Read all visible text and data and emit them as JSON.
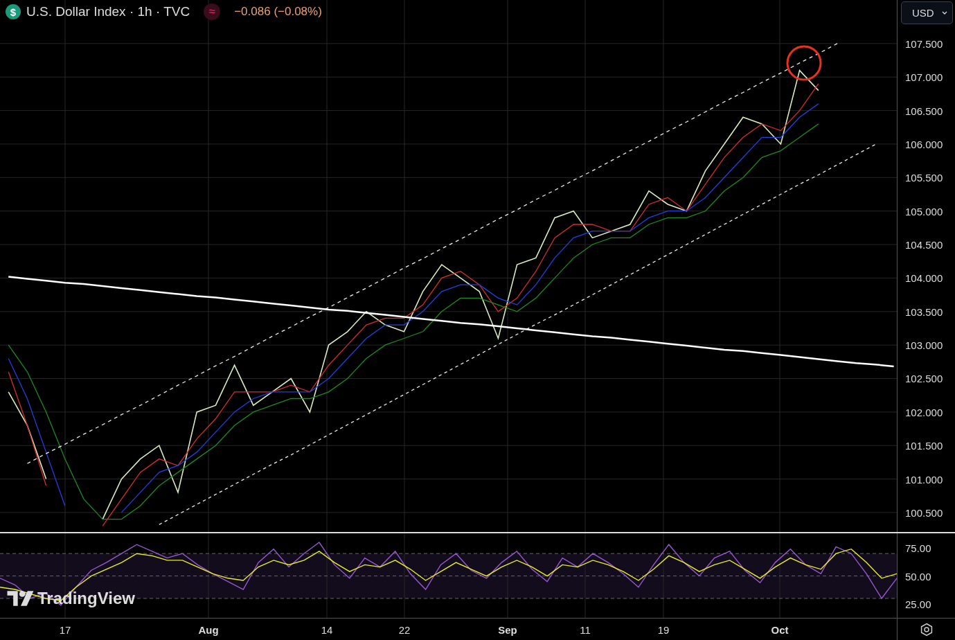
{
  "header": {
    "symbol_icon": "$",
    "title": "U.S. Dollar Index · 1h · TVC",
    "indicator_icon": "≈",
    "change": "−0.086 (−0.08%)"
  },
  "currency_button": {
    "label": "USD"
  },
  "price_chart": {
    "chart_data": {
      "type": "line",
      "grid": true,
      "ylim": [
        100.21,
        108.15
      ],
      "categories": [
        null,
        null,
        null,
        null,
        null,
        null,
        null,
        null,
        null,
        null,
        null,
        null,
        null,
        null,
        null,
        null,
        null,
        null,
        null,
        null,
        null,
        null,
        null,
        null,
        null,
        null,
        null,
        null,
        null,
        null,
        null,
        null,
        null,
        null,
        null,
        null,
        null,
        null,
        null,
        null,
        null,
        null,
        null,
        null,
        null,
        null,
        null,
        null
      ],
      "series": [
        {
          "color": "#d8ecc0",
          "values": [
            102.3,
            101.8,
            101.0,
            null,
            null,
            100.4,
            101.0,
            101.3,
            101.5,
            100.8,
            102.0,
            102.1,
            102.7,
            102.1,
            102.3,
            102.5,
            102.0,
            103.0,
            103.2,
            103.5,
            103.3,
            103.2,
            103.8,
            104.2,
            104.0,
            103.8,
            103.1,
            104.2,
            104.3,
            104.9,
            105.0,
            104.6,
            104.7,
            104.8,
            105.3,
            105.1,
            105.0,
            105.6,
            106.0,
            106.4,
            106.3,
            106.0,
            107.1,
            106.8,
            null,
            null,
            null,
            null
          ]
        },
        {
          "color": "#d32f2f",
          "values": [
            102.6,
            101.8,
            100.9,
            null,
            null,
            100.3,
            100.7,
            101.1,
            101.3,
            101.2,
            101.6,
            101.9,
            102.3,
            102.3,
            102.3,
            102.4,
            102.3,
            102.7,
            103.0,
            103.3,
            103.4,
            103.4,
            103.6,
            104.0,
            104.1,
            103.9,
            103.5,
            103.7,
            104.1,
            104.6,
            104.8,
            104.8,
            104.7,
            104.7,
            105.1,
            105.2,
            105.0,
            105.4,
            105.8,
            106.1,
            106.3,
            106.2,
            106.5,
            106.9,
            null,
            null,
            null,
            null
          ]
        },
        {
          "color": "#2340e0",
          "values": [
            102.8,
            102.2,
            101.4,
            100.6,
            null,
            null,
            100.5,
            100.8,
            101.1,
            101.2,
            101.4,
            101.7,
            102.0,
            102.2,
            102.3,
            102.3,
            102.3,
            102.5,
            102.8,
            103.1,
            103.3,
            103.3,
            103.5,
            103.8,
            103.9,
            103.9,
            103.7,
            103.6,
            103.9,
            104.3,
            104.6,
            104.7,
            104.7,
            104.7,
            104.9,
            105.0,
            105.0,
            105.2,
            105.5,
            105.8,
            106.1,
            106.1,
            106.4,
            106.6,
            null,
            null,
            null,
            null
          ]
        },
        {
          "color": "#1f8a1f",
          "values": [
            103.0,
            102.6,
            102.0,
            101.3,
            100.7,
            100.4,
            100.4,
            100.6,
            100.9,
            101.1,
            101.3,
            101.5,
            101.8,
            102.0,
            102.1,
            102.2,
            102.2,
            102.3,
            102.5,
            102.8,
            103.0,
            103.1,
            103.2,
            103.5,
            103.7,
            103.7,
            103.6,
            103.5,
            103.7,
            104.0,
            104.3,
            104.5,
            104.6,
            104.6,
            104.8,
            104.9,
            104.9,
            105.0,
            105.3,
            105.5,
            105.8,
            105.9,
            106.1,
            106.3,
            null,
            null,
            null,
            null
          ]
        },
        {
          "color": "#eeeeee",
          "line_style": "dashed",
          "values": [
            null,
            101.23,
            101.38,
            101.52,
            101.67,
            101.81,
            101.96,
            102.1,
            102.25,
            102.4,
            102.54,
            102.69,
            102.83,
            102.98,
            103.13,
            103.27,
            103.42,
            103.56,
            103.71,
            103.85,
            104.0,
            104.15,
            104.29,
            104.44,
            104.58,
            104.73,
            104.88,
            105.02,
            105.17,
            105.31,
            105.46,
            105.6,
            105.75,
            105.9,
            106.04,
            106.19,
            106.33,
            106.48,
            106.63,
            106.77,
            106.92,
            107.06,
            107.21,
            107.35,
            107.5,
            null,
            null,
            null
          ]
        },
        {
          "color": "#eeeeee",
          "line_style": "dashed",
          "values": [
            null,
            null,
            null,
            null,
            null,
            null,
            null,
            null,
            100.32,
            100.47,
            100.62,
            100.77,
            100.92,
            101.07,
            101.22,
            101.36,
            101.51,
            101.66,
            101.81,
            101.96,
            102.11,
            102.26,
            102.41,
            102.56,
            102.71,
            102.86,
            103.01,
            103.16,
            103.31,
            103.45,
            103.6,
            103.75,
            103.9,
            104.05,
            104.2,
            104.35,
            104.5,
            104.65,
            104.8,
            104.95,
            105.1,
            105.25,
            105.4,
            105.54,
            105.69,
            105.84,
            105.99,
            null
          ]
        },
        {
          "color": "#ffffff",
          "values": [
            104.02,
            103.99,
            103.96,
            103.93,
            103.91,
            103.88,
            103.85,
            103.82,
            103.79,
            103.76,
            103.73,
            103.71,
            103.68,
            103.65,
            103.62,
            103.59,
            103.56,
            103.53,
            103.51,
            103.48,
            103.45,
            103.42,
            103.39,
            103.36,
            103.33,
            103.31,
            103.28,
            103.25,
            103.22,
            103.19,
            103.16,
            103.13,
            103.11,
            103.08,
            103.05,
            103.02,
            102.99,
            102.96,
            102.93,
            102.91,
            102.88,
            102.85,
            102.82,
            102.79,
            102.76,
            102.73,
            102.71,
            102.68
          ]
        }
      ],
      "yticks": [
        {
          "value": 107.5,
          "label": "107.500"
        },
        {
          "value": 107,
          "label": "107.000"
        },
        {
          "value": 106.5,
          "label": "106.500"
        },
        {
          "value": 106,
          "label": "106.000"
        },
        {
          "value": 105.5,
          "label": "105.500"
        },
        {
          "value": 105,
          "label": "105.000"
        },
        {
          "value": 104.5,
          "label": "104.500"
        },
        {
          "value": 104,
          "label": "104.000"
        },
        {
          "value": 103.5,
          "label": "103.500"
        },
        {
          "value": 103,
          "label": "103.000"
        },
        {
          "value": 102.5,
          "label": "102.500"
        },
        {
          "value": 102,
          "label": "102.000"
        },
        {
          "value": 101.5,
          "label": "101.500"
        },
        {
          "value": 101,
          "label": "101.000"
        },
        {
          "value": 100.5,
          "label": "100.500"
        }
      ]
    }
  },
  "rsi_pane": {
    "chart_data": {
      "type": "line",
      "ylim": [
        12.7,
        88
      ],
      "series": [
        {
          "color": "#9b59d0",
          "values": [
            48,
            42,
            30,
            35,
            24,
            40,
            55,
            62,
            70,
            78,
            72,
            66,
            70,
            60,
            52,
            45,
            38,
            62,
            74,
            58,
            70,
            80,
            60,
            48,
            66,
            58,
            72,
            52,
            38,
            60,
            70,
            55,
            48,
            62,
            72,
            56,
            45,
            66,
            58,
            70,
            62,
            52,
            40,
            60,
            78,
            62,
            50,
            66,
            72,
            55,
            44,
            62,
            74,
            60,
            52,
            76,
            70,
            52,
            30,
            48
          ]
        },
        {
          "color": "#e8f020",
          "values": [
            40,
            38,
            34,
            30,
            28,
            40,
            50,
            56,
            62,
            70,
            68,
            64,
            64,
            58,
            52,
            48,
            46,
            58,
            64,
            60,
            64,
            72,
            62,
            54,
            60,
            58,
            64,
            56,
            46,
            54,
            62,
            56,
            50,
            58,
            64,
            58,
            50,
            60,
            58,
            64,
            60,
            54,
            46,
            56,
            68,
            62,
            54,
            60,
            64,
            56,
            48,
            58,
            66,
            60,
            56,
            70,
            74,
            62,
            48,
            52
          ]
        }
      ],
      "yticks": [
        {
          "value": 75,
          "label": "75.00"
        },
        {
          "value": 50,
          "label": "50.00"
        },
        {
          "value": 25,
          "label": "25.00"
        }
      ]
    }
  },
  "time_axis": {
    "labels": [
      {
        "label": "17",
        "kind": "day"
      },
      {
        "label": "Aug",
        "kind": "month"
      },
      {
        "label": "14",
        "kind": "day"
      },
      {
        "label": "22",
        "kind": "day"
      },
      {
        "label": "Sep",
        "kind": "month"
      },
      {
        "label": "11",
        "kind": "day"
      },
      {
        "label": "19",
        "kind": "day"
      },
      {
        "label": "Oct",
        "kind": "month"
      }
    ]
  },
  "logo": {
    "text": "TradingView"
  }
}
